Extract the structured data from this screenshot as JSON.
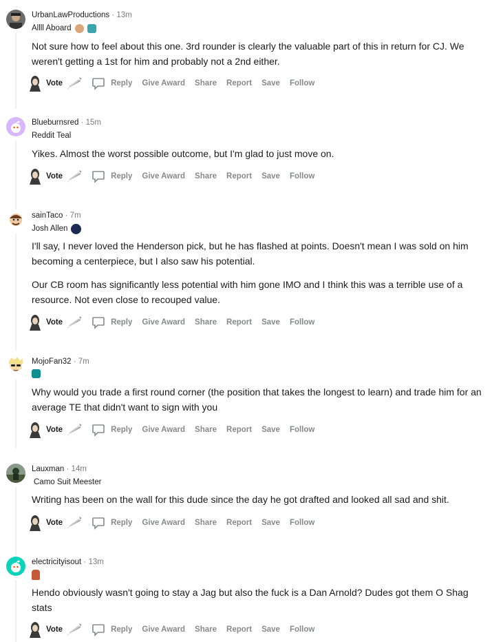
{
  "vote_label": "Vote",
  "actions": {
    "reply": "Reply",
    "give_award": "Give Award",
    "share": "Share",
    "report": "Report",
    "save": "Save",
    "follow": "Follow"
  },
  "comments": [
    {
      "author": "UrbanLawProductions",
      "time": "13m",
      "flair": "Allll Aboard",
      "paragraphs": [
        "Not sure how to feel about this one. 3rd rounder is clearly the valuable part of this in return for CJ. We weren't getting a 1st for him and probably not a 2nd either."
      ]
    },
    {
      "author": "Blueburnsred",
      "time": "15m",
      "flair": "Reddit Teal",
      "paragraphs": [
        "Yikes. Almost the worst possible outcome, but I'm glad to just move on."
      ]
    },
    {
      "author": "sainTaco",
      "time": "7m",
      "flair": "Josh Allen",
      "paragraphs": [
        "I'll say, I never loved the Henderson pick, but he has flashed at points. Doesn't mean I was sold on him becoming a centerpiece, but I also saw his potential.",
        "Our CB room has significantly less potential with him gone IMO and I think this was a terrible use of a resource. Not even close to recouped value."
      ]
    },
    {
      "author": "MojoFan32",
      "time": "7m",
      "flair": "",
      "paragraphs": [
        "Why would you trade a first round corner (the position that takes the longest to learn) and trade him for an average TE that didn't want to sign with you"
      ]
    },
    {
      "author": "Lauxman",
      "time": "14m",
      "flair": "Camo Suit Meester",
      "paragraphs": [
        "Writing has been on the wall for this dude since the day he got drafted and looked all sad and shit."
      ]
    },
    {
      "author": "electricityisout",
      "time": "13m",
      "flair": "",
      "paragraphs": [
        "Hendo obviously wasn't going to stay a Jag but also the fuck is a Dan Arnold? Dudes got them O Shag stats"
      ]
    }
  ],
  "colors": {
    "accent_blue": "#0079d3",
    "meta_gray": "#7c7c7c",
    "action_gray": "#878a8c",
    "teal": "#0dd3bb"
  },
  "icons": [
    "avatar",
    "flair-emoji",
    "vote-left-icon",
    "vote-right-icon",
    "reply-icon"
  ]
}
